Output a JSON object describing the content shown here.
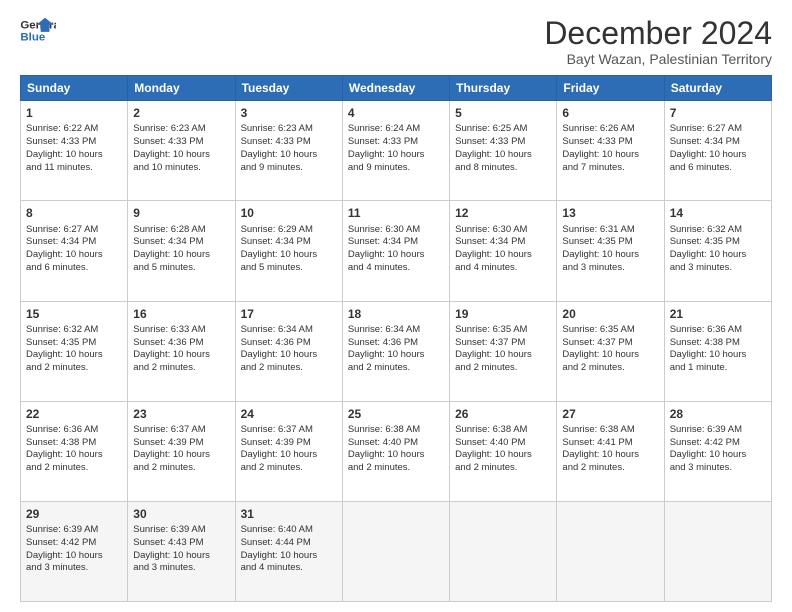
{
  "logo": {
    "line1": "General",
    "line2": "Blue"
  },
  "title": "December 2024",
  "subtitle": "Bayt Wazan, Palestinian Territory",
  "days_of_week": [
    "Sunday",
    "Monday",
    "Tuesday",
    "Wednesday",
    "Thursday",
    "Friday",
    "Saturday"
  ],
  "weeks": [
    [
      {
        "day": "1",
        "info": "Sunrise: 6:22 AM\nSunset: 4:33 PM\nDaylight: 10 hours\nand 11 minutes."
      },
      {
        "day": "2",
        "info": "Sunrise: 6:23 AM\nSunset: 4:33 PM\nDaylight: 10 hours\nand 10 minutes."
      },
      {
        "day": "3",
        "info": "Sunrise: 6:23 AM\nSunset: 4:33 PM\nDaylight: 10 hours\nand 9 minutes."
      },
      {
        "day": "4",
        "info": "Sunrise: 6:24 AM\nSunset: 4:33 PM\nDaylight: 10 hours\nand 9 minutes."
      },
      {
        "day": "5",
        "info": "Sunrise: 6:25 AM\nSunset: 4:33 PM\nDaylight: 10 hours\nand 8 minutes."
      },
      {
        "day": "6",
        "info": "Sunrise: 6:26 AM\nSunset: 4:33 PM\nDaylight: 10 hours\nand 7 minutes."
      },
      {
        "day": "7",
        "info": "Sunrise: 6:27 AM\nSunset: 4:34 PM\nDaylight: 10 hours\nand 6 minutes."
      }
    ],
    [
      {
        "day": "8",
        "info": "Sunrise: 6:27 AM\nSunset: 4:34 PM\nDaylight: 10 hours\nand 6 minutes."
      },
      {
        "day": "9",
        "info": "Sunrise: 6:28 AM\nSunset: 4:34 PM\nDaylight: 10 hours\nand 5 minutes."
      },
      {
        "day": "10",
        "info": "Sunrise: 6:29 AM\nSunset: 4:34 PM\nDaylight: 10 hours\nand 5 minutes."
      },
      {
        "day": "11",
        "info": "Sunrise: 6:30 AM\nSunset: 4:34 PM\nDaylight: 10 hours\nand 4 minutes."
      },
      {
        "day": "12",
        "info": "Sunrise: 6:30 AM\nSunset: 4:34 PM\nDaylight: 10 hours\nand 4 minutes."
      },
      {
        "day": "13",
        "info": "Sunrise: 6:31 AM\nSunset: 4:35 PM\nDaylight: 10 hours\nand 3 minutes."
      },
      {
        "day": "14",
        "info": "Sunrise: 6:32 AM\nSunset: 4:35 PM\nDaylight: 10 hours\nand 3 minutes."
      }
    ],
    [
      {
        "day": "15",
        "info": "Sunrise: 6:32 AM\nSunset: 4:35 PM\nDaylight: 10 hours\nand 2 minutes."
      },
      {
        "day": "16",
        "info": "Sunrise: 6:33 AM\nSunset: 4:36 PM\nDaylight: 10 hours\nand 2 minutes."
      },
      {
        "day": "17",
        "info": "Sunrise: 6:34 AM\nSunset: 4:36 PM\nDaylight: 10 hours\nand 2 minutes."
      },
      {
        "day": "18",
        "info": "Sunrise: 6:34 AM\nSunset: 4:36 PM\nDaylight: 10 hours\nand 2 minutes."
      },
      {
        "day": "19",
        "info": "Sunrise: 6:35 AM\nSunset: 4:37 PM\nDaylight: 10 hours\nand 2 minutes."
      },
      {
        "day": "20",
        "info": "Sunrise: 6:35 AM\nSunset: 4:37 PM\nDaylight: 10 hours\nand 2 minutes."
      },
      {
        "day": "21",
        "info": "Sunrise: 6:36 AM\nSunset: 4:38 PM\nDaylight: 10 hours\nand 1 minute."
      }
    ],
    [
      {
        "day": "22",
        "info": "Sunrise: 6:36 AM\nSunset: 4:38 PM\nDaylight: 10 hours\nand 2 minutes."
      },
      {
        "day": "23",
        "info": "Sunrise: 6:37 AM\nSunset: 4:39 PM\nDaylight: 10 hours\nand 2 minutes."
      },
      {
        "day": "24",
        "info": "Sunrise: 6:37 AM\nSunset: 4:39 PM\nDaylight: 10 hours\nand 2 minutes."
      },
      {
        "day": "25",
        "info": "Sunrise: 6:38 AM\nSunset: 4:40 PM\nDaylight: 10 hours\nand 2 minutes."
      },
      {
        "day": "26",
        "info": "Sunrise: 6:38 AM\nSunset: 4:40 PM\nDaylight: 10 hours\nand 2 minutes."
      },
      {
        "day": "27",
        "info": "Sunrise: 6:38 AM\nSunset: 4:41 PM\nDaylight: 10 hours\nand 2 minutes."
      },
      {
        "day": "28",
        "info": "Sunrise: 6:39 AM\nSunset: 4:42 PM\nDaylight: 10 hours\nand 3 minutes."
      }
    ],
    [
      {
        "day": "29",
        "info": "Sunrise: 6:39 AM\nSunset: 4:42 PM\nDaylight: 10 hours\nand 3 minutes."
      },
      {
        "day": "30",
        "info": "Sunrise: 6:39 AM\nSunset: 4:43 PM\nDaylight: 10 hours\nand 3 minutes."
      },
      {
        "day": "31",
        "info": "Sunrise: 6:40 AM\nSunset: 4:44 PM\nDaylight: 10 hours\nand 4 minutes."
      },
      {
        "day": "",
        "info": ""
      },
      {
        "day": "",
        "info": ""
      },
      {
        "day": "",
        "info": ""
      },
      {
        "day": "",
        "info": ""
      }
    ]
  ]
}
